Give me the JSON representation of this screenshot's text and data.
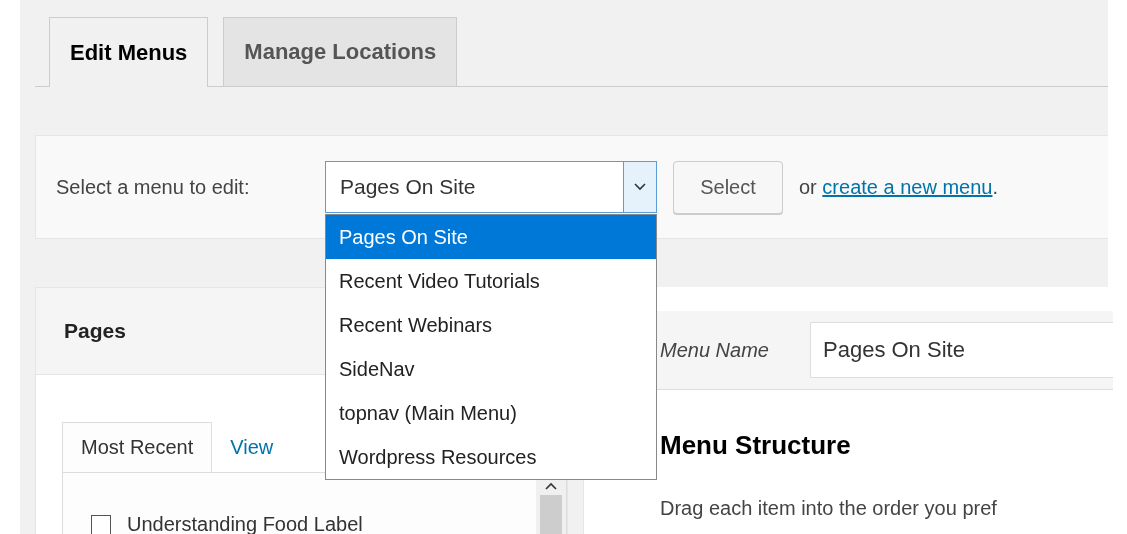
{
  "tabs": [
    {
      "label": "Edit Menus",
      "selected": true
    },
    {
      "label": "Manage Locations",
      "selected": false
    }
  ],
  "menu_select": {
    "label": "Select a menu to edit:",
    "value": "Pages On Site",
    "expanded": true,
    "options": [
      {
        "label": "Pages On Site",
        "selected": true
      },
      {
        "label": "Recent Video Tutorials",
        "selected": false
      },
      {
        "label": "Recent Webinars",
        "selected": false
      },
      {
        "label": "SideNav",
        "selected": false
      },
      {
        "label": "topnav (Main Menu)",
        "selected": false
      },
      {
        "label": "Wordpress Resources",
        "selected": false
      }
    ],
    "button": "Select",
    "or_text": "or",
    "link": "create a new menu",
    "link_end": "."
  },
  "pages_panel": {
    "title": "Pages",
    "tabs": [
      {
        "label": "Most Recent",
        "selected": true
      },
      {
        "label": "View",
        "selected": false
      }
    ],
    "items": [
      {
        "label": "Understanding Food Label",
        "checked": false
      }
    ]
  },
  "menu_editor": {
    "name_label": "Menu Name",
    "name_value": "Pages On Site",
    "heading": "Menu Structure",
    "description": "Drag each item into the order you pref"
  }
}
